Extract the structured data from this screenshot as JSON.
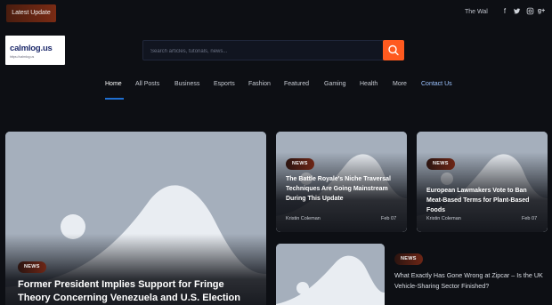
{
  "topbar": {
    "latest_label": "Latest Update",
    "ticker_text": "The Wal"
  },
  "social_icons": [
    "facebook-icon",
    "twitter-icon",
    "instagram-icon",
    "google-plus-icon"
  ],
  "logo": {
    "name": "calmlog.us",
    "tagline": "https://calmlog.us"
  },
  "search": {
    "placeholder": "Search articles, tutorials, news..."
  },
  "nav": {
    "items": [
      "Home",
      "All Posts",
      "Business",
      "Esports",
      "Fashion",
      "Featured",
      "Gaming",
      "Health",
      "More",
      "Contact Us"
    ],
    "active": "Home"
  },
  "featured": {
    "badge": "NEWS",
    "title": "Former President Implies Support for Fringe Theory Concerning Venezuela and U.S. Election"
  },
  "cards": [
    {
      "badge": "NEWS",
      "title": "The Battle Royale's Niche Traversal Techniques Are Going Mainstream During This Update",
      "author": "Kristin Coleman",
      "date": "Feb 07"
    },
    {
      "badge": "NEWS",
      "title": "European Lawmakers Vote to Ban Meat-Based Terms for Plant-Based Foods",
      "author": "Kristin Coleman",
      "date": "Feb 07"
    }
  ],
  "side_post": {
    "badge": "NEWS",
    "title": "What Exactly Has Gone Wrong at Zipcar – Is the UK Vehicle-Sharing Sector Finished?"
  },
  "colors": {
    "background": "#0d0f14",
    "accent": "#ff5a1f",
    "nav_underline": "#1f6fd1",
    "link_blue": "#9cc3ff"
  }
}
